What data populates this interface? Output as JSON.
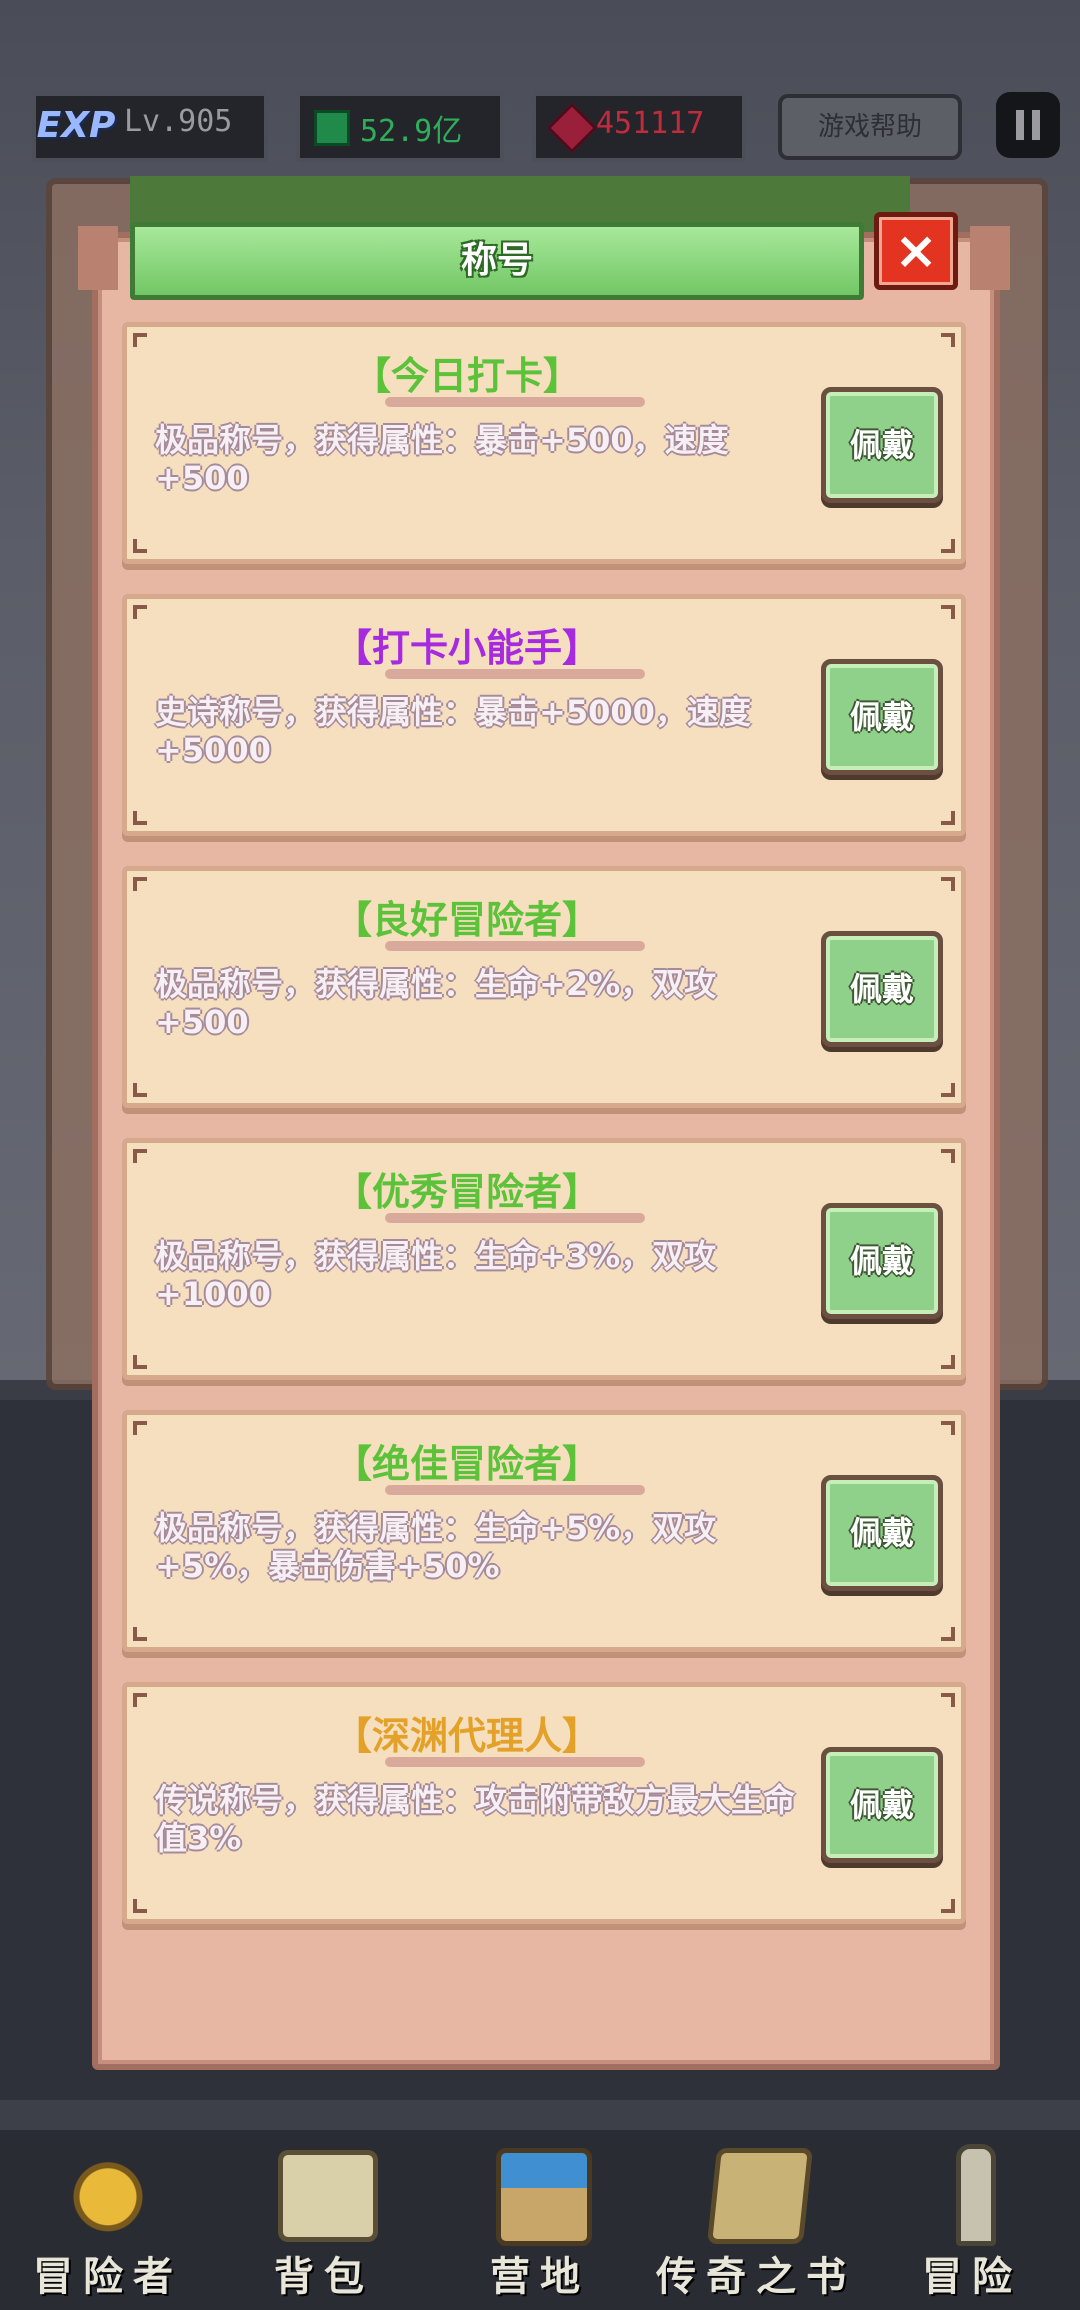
{
  "topbar": {
    "exp_tag": "EXP",
    "level": "Lv.905",
    "emerald": "52.9亿",
    "ruby": "451117",
    "help": "游戏帮助",
    "colors": {
      "emerald": "#2fae5a",
      "ruby": "#c22b3c"
    }
  },
  "modal": {
    "title": "称号",
    "close_icon": "×"
  },
  "titles": [
    {
      "name": "【今日打卡】",
      "color": "#5cc23a",
      "desc": "极品称号，获得属性：暴击+500，速度+500",
      "button": "佩戴"
    },
    {
      "name": "【打卡小能手】",
      "color": "#a62ae0",
      "desc": "史诗称号，获得属性：暴击+5000，速度+5000",
      "button": "佩戴"
    },
    {
      "name": "【良好冒险者】",
      "color": "#5cc23a",
      "desc": "极品称号，获得属性：生命+2%，双攻+500",
      "button": "佩戴"
    },
    {
      "name": "【优秀冒险者】",
      "color": "#5cc23a",
      "desc": "极品称号，获得属性：生命+3%，双攻+1000",
      "button": "佩戴"
    },
    {
      "name": "【绝佳冒险者】",
      "color": "#5cc23a",
      "desc": "极品称号，获得属性：生命+5%，双攻+5%，暴击伤害+50%",
      "button": "佩戴"
    },
    {
      "name": "【深渊代理人】",
      "color": "#e4a12a",
      "desc": "传说称号，获得属性：攻击附带敌方最大生命值3%",
      "button": "佩戴"
    }
  ],
  "nav": [
    {
      "label": "冒险者",
      "icon": "crown-icon"
    },
    {
      "label": "背包",
      "icon": "backpack-icon"
    },
    {
      "label": "营地",
      "icon": "camp-icon"
    },
    {
      "label": "传奇之书",
      "icon": "book-icon"
    },
    {
      "label": "冒险",
      "icon": "sword-icon"
    }
  ]
}
